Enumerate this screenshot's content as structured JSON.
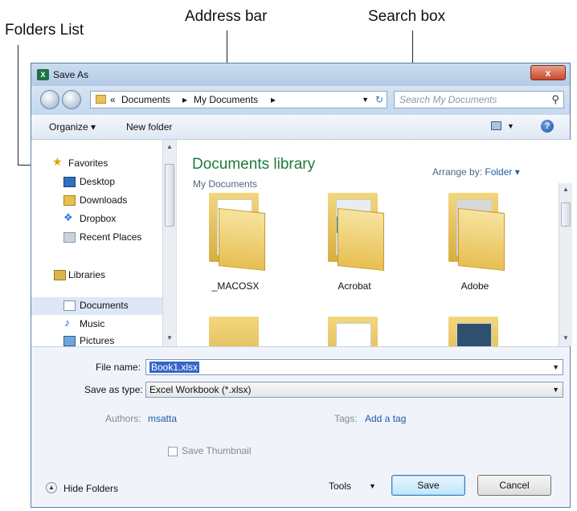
{
  "callouts": {
    "folders_list": "Folders List",
    "address_bar": "Address bar",
    "search_box": "Search box"
  },
  "window": {
    "title": "Save As",
    "app_icon": "excel-icon",
    "close_glyph": "x"
  },
  "address": {
    "prefix": "«",
    "crumbs": [
      "Documents",
      "My Documents"
    ],
    "separator": "▸",
    "search_placeholder": "Search My Documents"
  },
  "toolbar": {
    "organize": "Organize ▾",
    "new_folder": "New folder"
  },
  "sidebar": {
    "favorites_label": "Favorites",
    "favorites": [
      "Desktop",
      "Downloads",
      "Dropbox",
      "Recent Places"
    ],
    "libraries_label": "Libraries",
    "libraries": [
      "Documents",
      "Music",
      "Pictures"
    ],
    "selected": "Documents"
  },
  "content": {
    "title": "Documents library",
    "subtitle": "My Documents",
    "arrange_label": "Arrange by:",
    "arrange_value": "Folder ▾",
    "folders": [
      "_MACOSX",
      "Acrobat",
      "Adobe"
    ]
  },
  "form": {
    "file_name_label": "File name:",
    "file_name_value": "Book1.xlsx",
    "save_type_label": "Save as type:",
    "save_type_value": "Excel Workbook (*.xlsx)",
    "authors_label": "Authors:",
    "authors_value": "msatta",
    "tags_label": "Tags:",
    "tags_value": "Add a tag",
    "thumbnail_label": "Save Thumbnail"
  },
  "footer": {
    "hide_folders": "Hide Folders",
    "tools": "Tools",
    "save": "Save",
    "cancel": "Cancel"
  }
}
